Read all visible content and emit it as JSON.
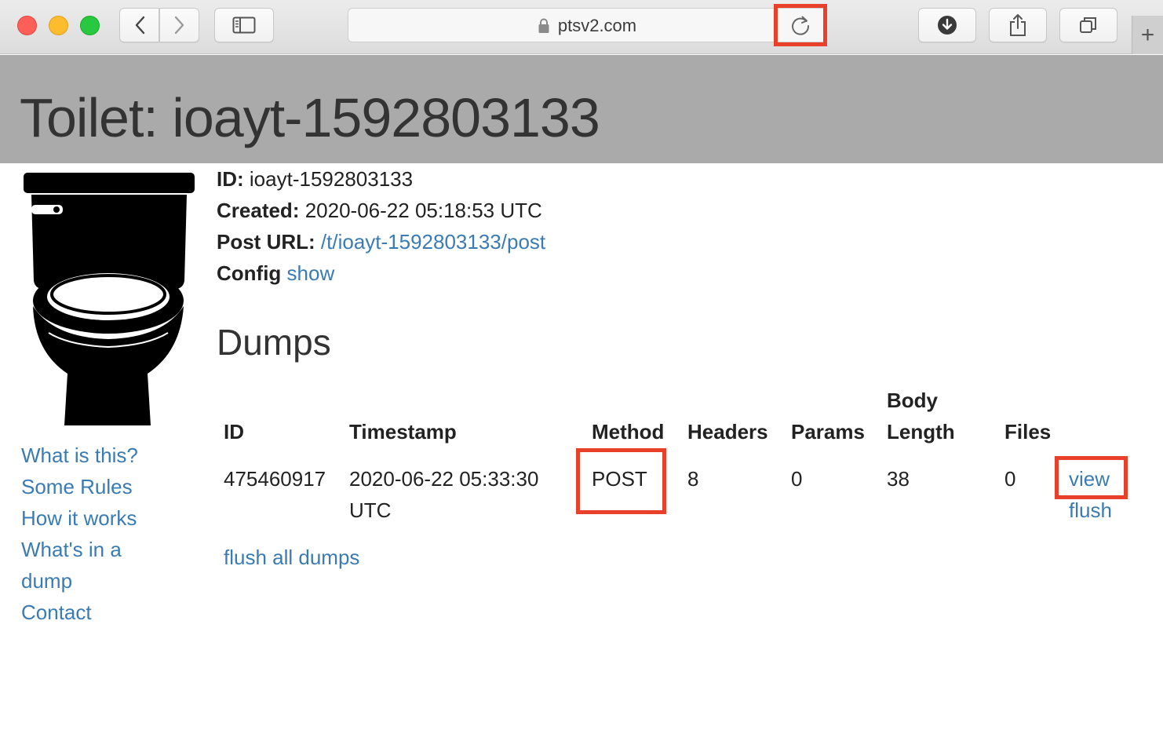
{
  "browser": {
    "url": "ptsv2.com",
    "new_tab_label": "+"
  },
  "page": {
    "title": "Toilet: ioayt-1592803133"
  },
  "info": {
    "id_label": "ID:",
    "id_value": "ioayt-1592803133",
    "created_label": "Created:",
    "created_value": "2020-06-22 05:18:53 UTC",
    "post_url_label": "Post URL:",
    "post_url_value": "/t/ioayt-1592803133/post",
    "config_label": "Config",
    "config_link": "show"
  },
  "sidebar": {
    "links": [
      "What is this?",
      "Some Rules",
      "How it works",
      "What's in a",
      "dump",
      "Contact"
    ]
  },
  "dumps": {
    "heading": "Dumps",
    "columns": {
      "id": "ID",
      "timestamp": "Timestamp",
      "method": "Method",
      "headers": "Headers",
      "params": "Params",
      "body_length_1": "Body",
      "body_length_2": "Length",
      "files": "Files"
    },
    "rows": [
      {
        "id": "475460917",
        "timestamp_1": "2020-06-22 05:33:30",
        "timestamp_2": "UTC",
        "method": "POST",
        "headers": "8",
        "params": "0",
        "body_length": "38",
        "files": "0",
        "view": "view",
        "flush": "flush"
      }
    ],
    "flush_all": "flush all dumps"
  },
  "colors": {
    "header_bg": "#aaaaaa",
    "link": "#3b7bb3",
    "highlight": "#e8402a"
  }
}
